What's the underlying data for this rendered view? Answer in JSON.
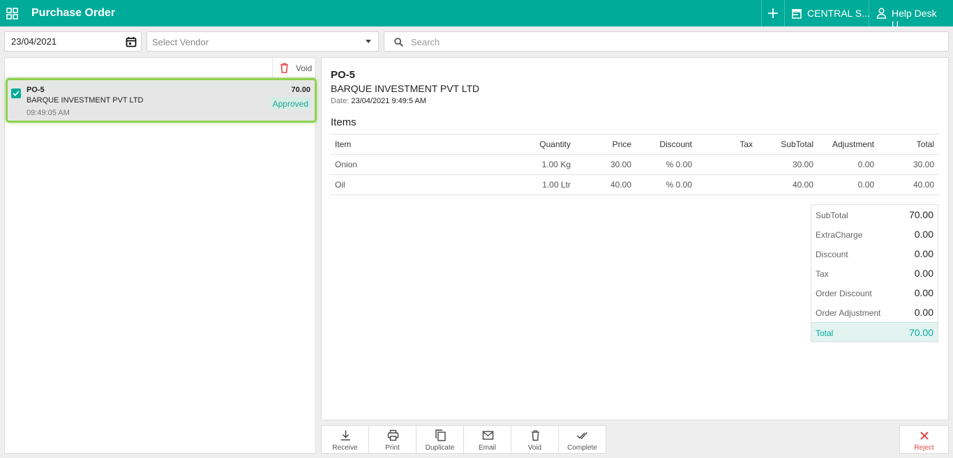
{
  "header": {
    "title": "Purchase Order",
    "store": "CENTRAL S...",
    "user": "Help Desk U...",
    "brand_color": "#00ab99"
  },
  "filters": {
    "date": "23/04/2021",
    "vendor_placeholder": "Select Vendor",
    "search_placeholder": "Search"
  },
  "list": {
    "void_label": "Void",
    "items": [
      {
        "number": "PO-5",
        "vendor": "BARQUE INVESTMENT PVT LTD",
        "time": "09:49:05 AM",
        "amount": "70.00",
        "status": "Approved",
        "checked": true
      }
    ]
  },
  "detail": {
    "number": "PO-5",
    "vendor": "BARQUE INVESTMENT PVT LTD",
    "date_label": "Date:",
    "date": "23/04/2021 9:49:5 AM",
    "items_title": "Items",
    "columns": [
      "Item",
      "Quantity",
      "Price",
      "Discount",
      "Tax",
      "SubTotal",
      "Adjustment",
      "Total"
    ],
    "rows": [
      {
        "item": "Onion",
        "quantity": "1.00 Kg",
        "price": "30.00",
        "discount": "% 0.00",
        "tax": "",
        "subtotal": "30.00",
        "adjustment": "0.00",
        "total": "30.00"
      },
      {
        "item": "Oil",
        "quantity": "1.00 Ltr",
        "price": "40.00",
        "discount": "% 0.00",
        "tax": "",
        "subtotal": "40.00",
        "adjustment": "0.00",
        "total": "40.00"
      }
    ],
    "summary": [
      {
        "label": "SubTotal",
        "value": "70.00"
      },
      {
        "label": "ExtraCharge",
        "value": "0.00"
      },
      {
        "label": "Discount",
        "value": "0.00"
      },
      {
        "label": "Tax",
        "value": "0.00"
      },
      {
        "label": "Order Discount",
        "value": "0.00"
      },
      {
        "label": "Order Adjustment",
        "value": "0.00"
      }
    ],
    "total_label": "Total",
    "total_value": "70.00"
  },
  "actions": {
    "receive": "Receive",
    "print": "Print",
    "duplicate": "Duplicate",
    "email": "Email",
    "void": "Void",
    "complete": "Complete",
    "reject": "Reject"
  }
}
